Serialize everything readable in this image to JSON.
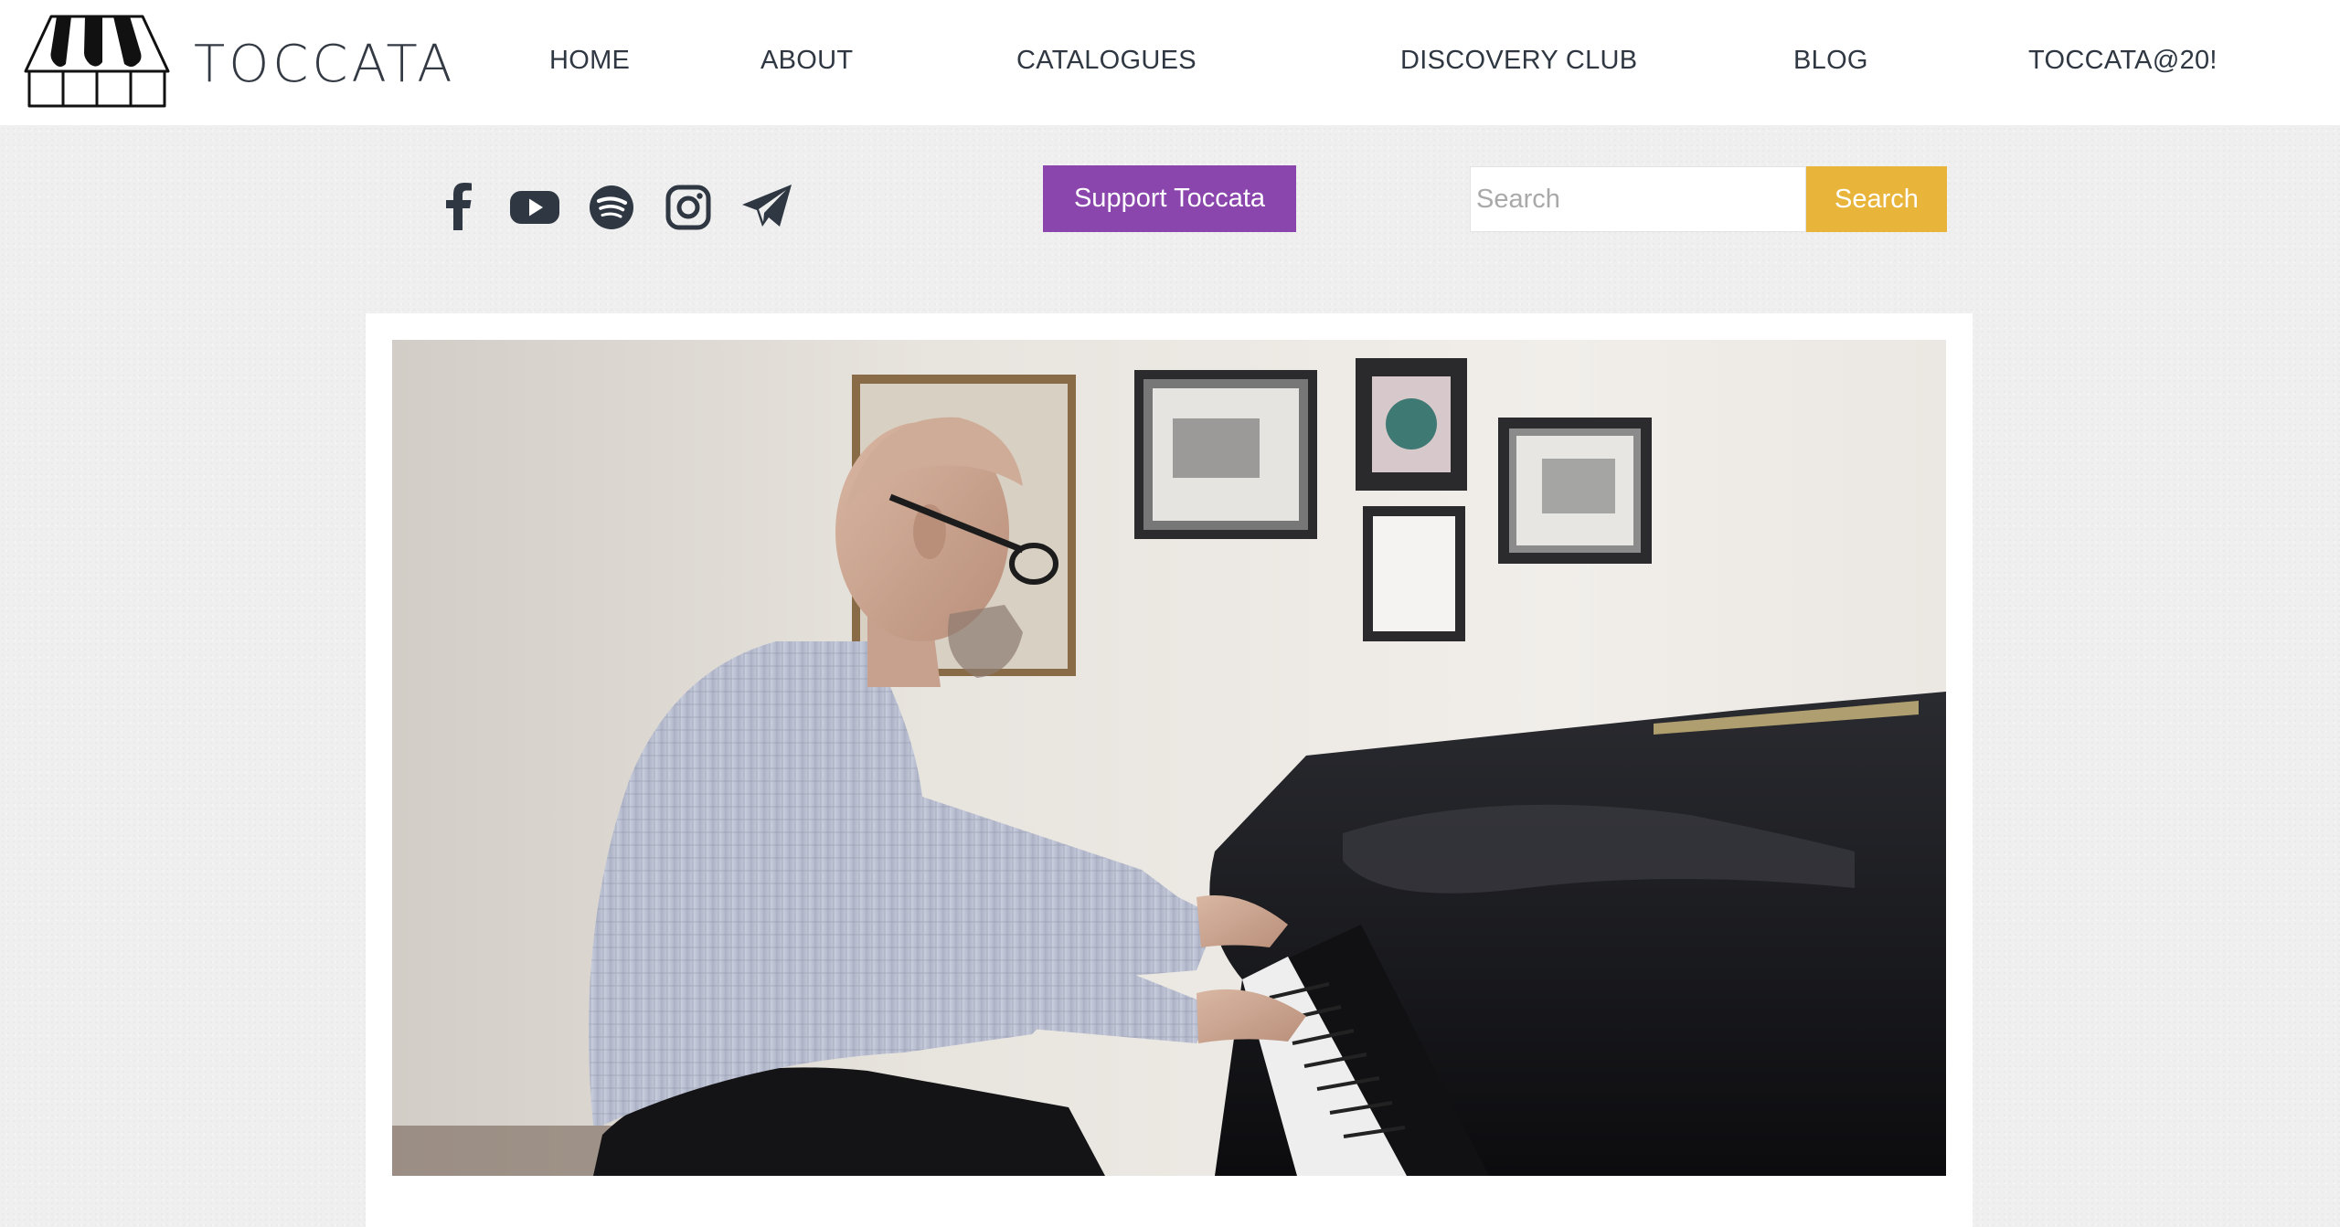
{
  "brand": {
    "name": "TOCCATA",
    "logo_icon": "piano-keys-logo"
  },
  "nav": {
    "items": [
      {
        "label": "HOME"
      },
      {
        "label": "ABOUT"
      },
      {
        "label": "CATALOGUES"
      },
      {
        "label": "DISCOVERY CLUB"
      },
      {
        "label": "BLOG"
      },
      {
        "label": "TOCCATA@20!"
      }
    ]
  },
  "social": {
    "icons": [
      "facebook-icon",
      "youtube-icon",
      "spotify-icon",
      "instagram-icon",
      "telegram-icon"
    ]
  },
  "support": {
    "label": "Support Toccata"
  },
  "search": {
    "placeholder": "Search",
    "value": "",
    "button_label": "Search"
  },
  "colors": {
    "accent_purple": "#8b46ad",
    "accent_gold": "#e8b43a",
    "text_dark": "#2f3742",
    "page_bg": "#efefef"
  }
}
